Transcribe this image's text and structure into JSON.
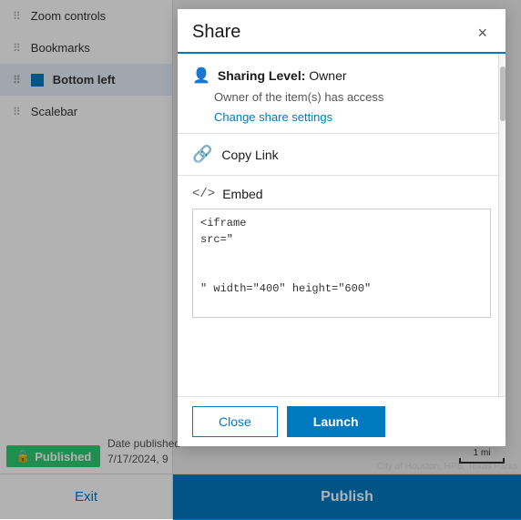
{
  "sidebar": {
    "items": [
      {
        "id": "zoom-controls",
        "label": "Zoom controls",
        "active": false
      },
      {
        "id": "bookmarks",
        "label": "Bookmarks",
        "active": false
      },
      {
        "id": "bottom-left",
        "label": "Bottom left",
        "active": true
      },
      {
        "id": "scalebar",
        "label": "Scalebar",
        "active": false
      }
    ]
  },
  "modal": {
    "title": "Share",
    "close_label": "×",
    "sharing_level_prefix": "Sharing Level: ",
    "sharing_level_value": "Owner",
    "sharing_desc": "Owner of the item(s) has access",
    "change_share_link": "Change share settings",
    "copy_link_label": "Copy Link",
    "embed_label": "Embed",
    "embed_code_line1": "<iframe",
    "embed_code_line2": "src=\"",
    "embed_code_line3": "\" width=\"400\" height=\"600\"",
    "close_button": "Close",
    "launch_button": "Launch"
  },
  "footer": {
    "exit_label": "Exit",
    "publish_label": "Publish"
  },
  "published": {
    "badge_label": "Published",
    "lock_icon": "🔒",
    "date_line1": "Date published",
    "date_line2": "7/17/2024, 9"
  },
  "map": {
    "scale_label": "1 mi",
    "attribution": "City of Houston, HPB, Texas Parks"
  }
}
